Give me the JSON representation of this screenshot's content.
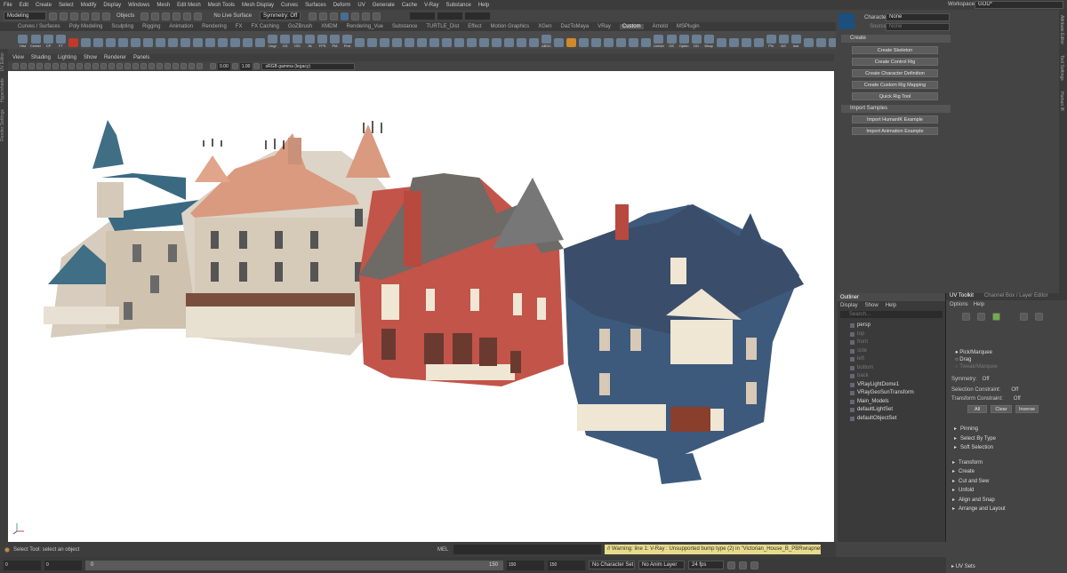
{
  "menubar": [
    "File",
    "Edit",
    "Create",
    "Select",
    "Modify",
    "Display",
    "Windows",
    "Mesh",
    "Edit Mesh",
    "Mesh Tools",
    "Mesh Display",
    "Curves",
    "Surfaces",
    "Deform",
    "UV",
    "Generate",
    "Cache",
    "V-Ray",
    "Substance",
    "Help"
  ],
  "workspace": {
    "label": "Workspace:",
    "value": "GOD*"
  },
  "status": {
    "mode": "Modeling",
    "objects": "Objects",
    "live": "No Live Surface",
    "symmetry": "Symmetry: Off"
  },
  "shelf_tabs": [
    "Curves / Surfaces",
    "Poly Modeling",
    "Sculpting",
    "Rigging",
    "Animation",
    "Rendering",
    "FX",
    "FX Caching",
    "GoZBrush",
    "XMDM",
    "Rendering_Vue",
    "Substance",
    "TURTLE_Dist",
    "Effect",
    "Motion Graphics",
    "XGen",
    "DazToMaya",
    "VRay",
    "Custom",
    "Arnold",
    "MSPlugin"
  ],
  "shelf_active": "Custom",
  "shelf_icons": [
    "Hist",
    "Center",
    "CP",
    "FT",
    "",
    "",
    "",
    "",
    "",
    "",
    "",
    "",
    "",
    "",
    "",
    "",
    "",
    "",
    "",
    "",
    "Ungr",
    "OS",
    "ISS",
    "IN",
    "FPS",
    "PM",
    "Prnt",
    "",
    "",
    "",
    "",
    "",
    "",
    "",
    "",
    "",
    "",
    "",
    "",
    "",
    "",
    "",
    "ABSC",
    "",
    "",
    "",
    "",
    "",
    "",
    "",
    "",
    "Unfold",
    "OS",
    "Optim",
    "DD",
    "Wrap",
    "",
    "",
    "",
    "",
    "PN",
    "NS",
    "Inst",
    "",
    "",
    ""
  ],
  "left_tabs": [
    "UV Editor",
    "Hypershade",
    "Render Settings"
  ],
  "viewport": {
    "menu": [
      "View",
      "Shading",
      "Lighting",
      "Show",
      "Renderer",
      "Panels"
    ],
    "val1": "0.00",
    "val2": "1.00",
    "colorspace": "sRGB gamma (legacy)"
  },
  "humanik": {
    "character_label": "Character:",
    "character_value": "None",
    "source_label": "Source:",
    "source_value": "None",
    "create_title": "Create",
    "buttons": [
      "Create Skeleton",
      "Create Control Rig",
      "Create Character Definition",
      "Create Custom Rig Mapping",
      "Quick Rig Tool"
    ],
    "import_title": "Import Samples",
    "import_buttons": [
      "Import HumanIK Example",
      "Import Animation Example"
    ]
  },
  "vtabs": [
    "Attribute Editor",
    "Tool Settings",
    "Human IK"
  ],
  "outliner": {
    "tabs": [
      "Outliner"
    ],
    "menu": [
      "Display",
      "Show",
      "Help"
    ],
    "search": "Search...",
    "items": [
      {
        "label": "persp",
        "dim": false
      },
      {
        "label": "top",
        "dim": true
      },
      {
        "label": "front",
        "dim": true
      },
      {
        "label": "side",
        "dim": true
      },
      {
        "label": "left",
        "dim": true
      },
      {
        "label": "bottom",
        "dim": true
      },
      {
        "label": "back",
        "dim": true
      },
      {
        "label": "VRayLightDome1",
        "dim": false
      },
      {
        "label": "VRayGeoSunTransform",
        "dim": false
      },
      {
        "label": "Main_Models",
        "dim": false
      },
      {
        "label": "defaultLightSet",
        "dim": false
      },
      {
        "label": "defaultObjectSet",
        "dim": false
      }
    ]
  },
  "uvtk": {
    "tabs": [
      "UV Toolkit",
      "Channel Box / Layer Editor"
    ],
    "menu": [
      "Options",
      "Help"
    ],
    "radio": [
      "Pick/Marquee",
      "Drag",
      "Tweak/Marquee"
    ],
    "symmetry_label": "Symmetry:",
    "symmetry_value": "Off",
    "sel_label": "Selection Constraint:",
    "sel_value": "Off",
    "trans_label": "Transform Constraint:",
    "trans_value": "Off",
    "buttons": [
      "All",
      "Clear",
      "Inverse"
    ],
    "sub_sections": [
      "Pinning",
      "Select By Type",
      "Soft Selection"
    ],
    "sections": [
      "Transform",
      "Create",
      "Cut and Sew",
      "Unfold",
      "Align and Snap",
      "Arrange and Layout"
    ],
    "footer": "UV Sets"
  },
  "bottom": {
    "help": "Select Tool: select an object",
    "mel": "MEL",
    "warning": "// Warning: line 1: V-Ray : Unsupported bump type (2) in \"Victorian_House_B_PBRwrapnet\"",
    "time_a": "0",
    "time_b": "0",
    "range_a": "150",
    "range_b": "150",
    "range_c": "150",
    "start": "0",
    "char": "No Character Set",
    "anim": "No Anim Layer",
    "fps": "24 fps"
  },
  "colors": {
    "wall_red": "#c2544a",
    "roof_blue": "#3d5a7c",
    "trim": "#efe6d4",
    "wall_cream": "#d8cfc0",
    "roof_teal": "#3f6e85"
  }
}
